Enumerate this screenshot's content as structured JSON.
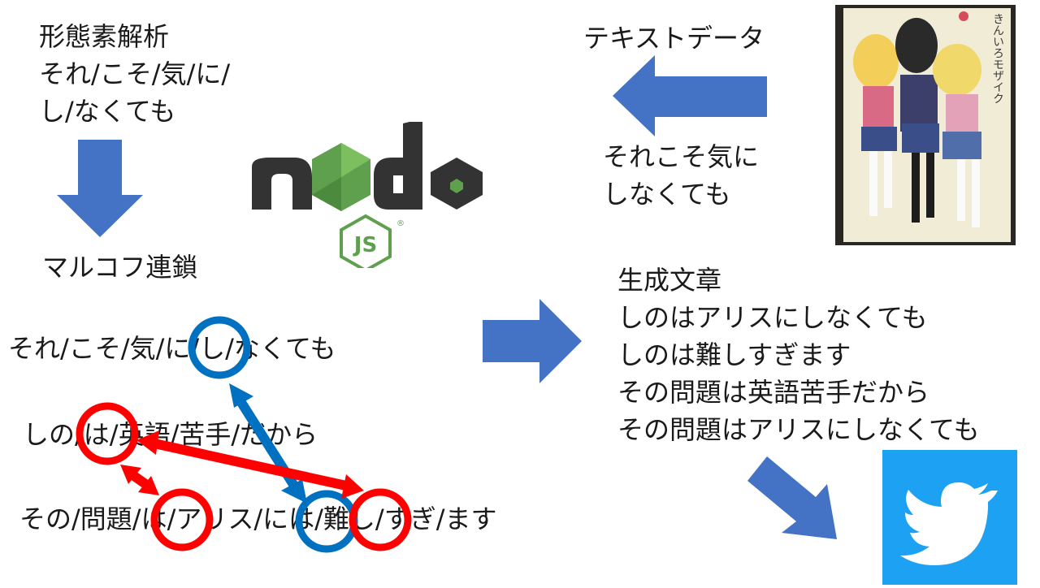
{
  "morph_title": "形態素解析",
  "morph_line1": "それ/こそ/気/に/",
  "morph_line2": "し/なくても",
  "markov_title": "マルコフ連鎖",
  "sentence1": "それ/こそ/気/に/し/なくても",
  "sentence2": "しの/は/英語/苦手/だから",
  "sentence3": "その/問題/は/アリス/には/難し/すぎ/ます",
  "text_data_label": "テキストデータ",
  "source_line1": "それこそ気に",
  "source_line2": "しなくても",
  "generated_title": "生成文章",
  "generated_lines": [
    "しのはアリスにしなくても",
    "しのは難しすぎます",
    "その問題は英語苦手だから",
    "その問題はアリスにしなくても"
  ],
  "node_logo_text": "node",
  "js_logo_text": "JS",
  "book_cover_text": "きんいろモザイク",
  "colors": {
    "arrow_blue": "#4472c4",
    "circle_blue": "#0070c0",
    "circle_red": "#ff0000",
    "node_dark": "#333333",
    "node_green": "#5fa04e",
    "twitter_blue": "#1da1f2"
  },
  "icons": [
    "node-js-logo",
    "book-cover-image",
    "twitter-bird-icon"
  ]
}
